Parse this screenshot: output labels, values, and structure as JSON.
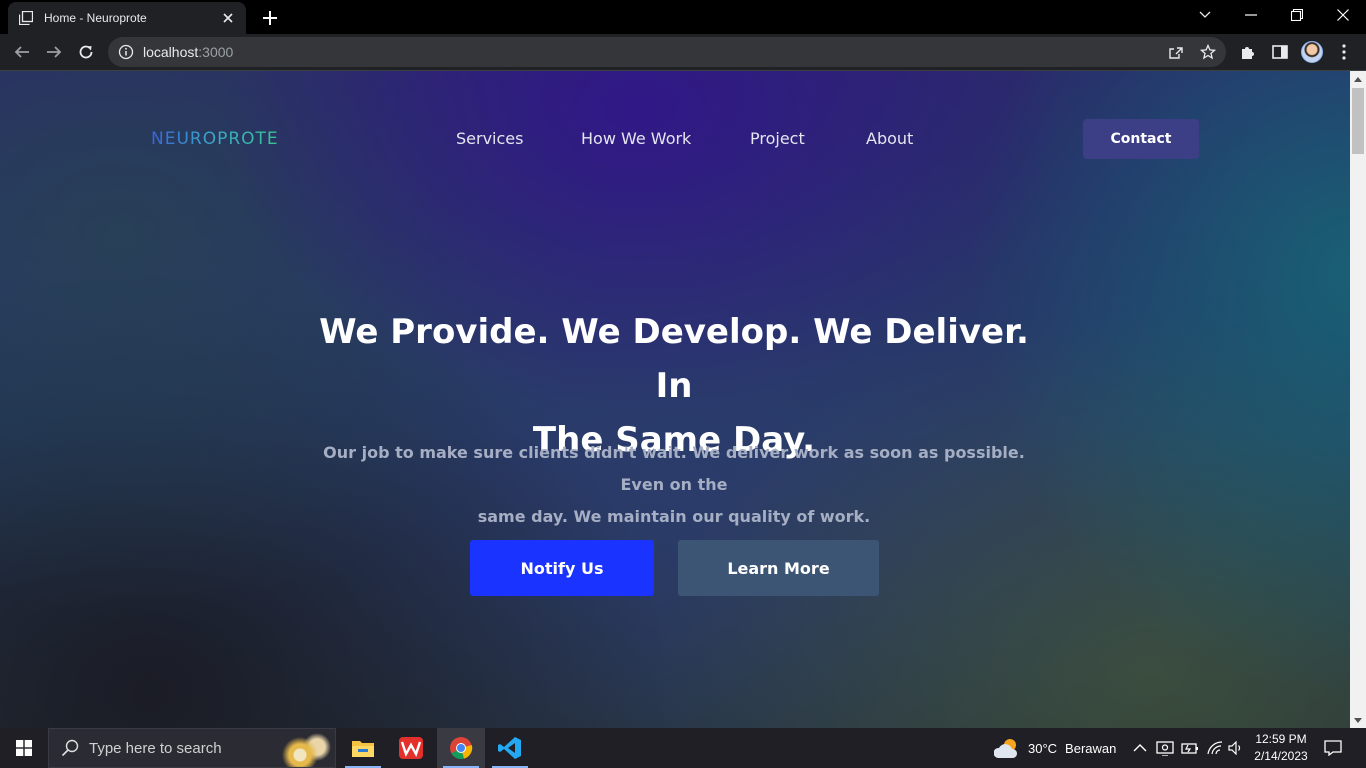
{
  "browser": {
    "tab_title": "Home - Neuroprote",
    "url_host": "localhost",
    "url_port": ":3000"
  },
  "site": {
    "logo": "NEUROPROTE",
    "nav": [
      "Services",
      "How We Work",
      "Project",
      "About"
    ],
    "contact": "Contact",
    "hero_title_line1": "We Provide. We Develop. We Deliver. In",
    "hero_title_line2": "The Same Day.",
    "hero_sub_line1": "Our job to make sure clients didn't wait. We deliver work as soon as possible. Even on the",
    "hero_sub_line2": "same day. We maintain our quality of work.",
    "notify": "Notify Us",
    "learn": "Learn More"
  },
  "taskbar": {
    "search_placeholder": "Type here to search",
    "weather_temp": "30°C",
    "weather_desc": "Berawan",
    "time": "12:59 PM",
    "date": "2/14/2023"
  },
  "colors": {
    "notify_button": "#1a33ff",
    "learn_button": "#3d5575",
    "contact_button": "#3d3f86"
  }
}
